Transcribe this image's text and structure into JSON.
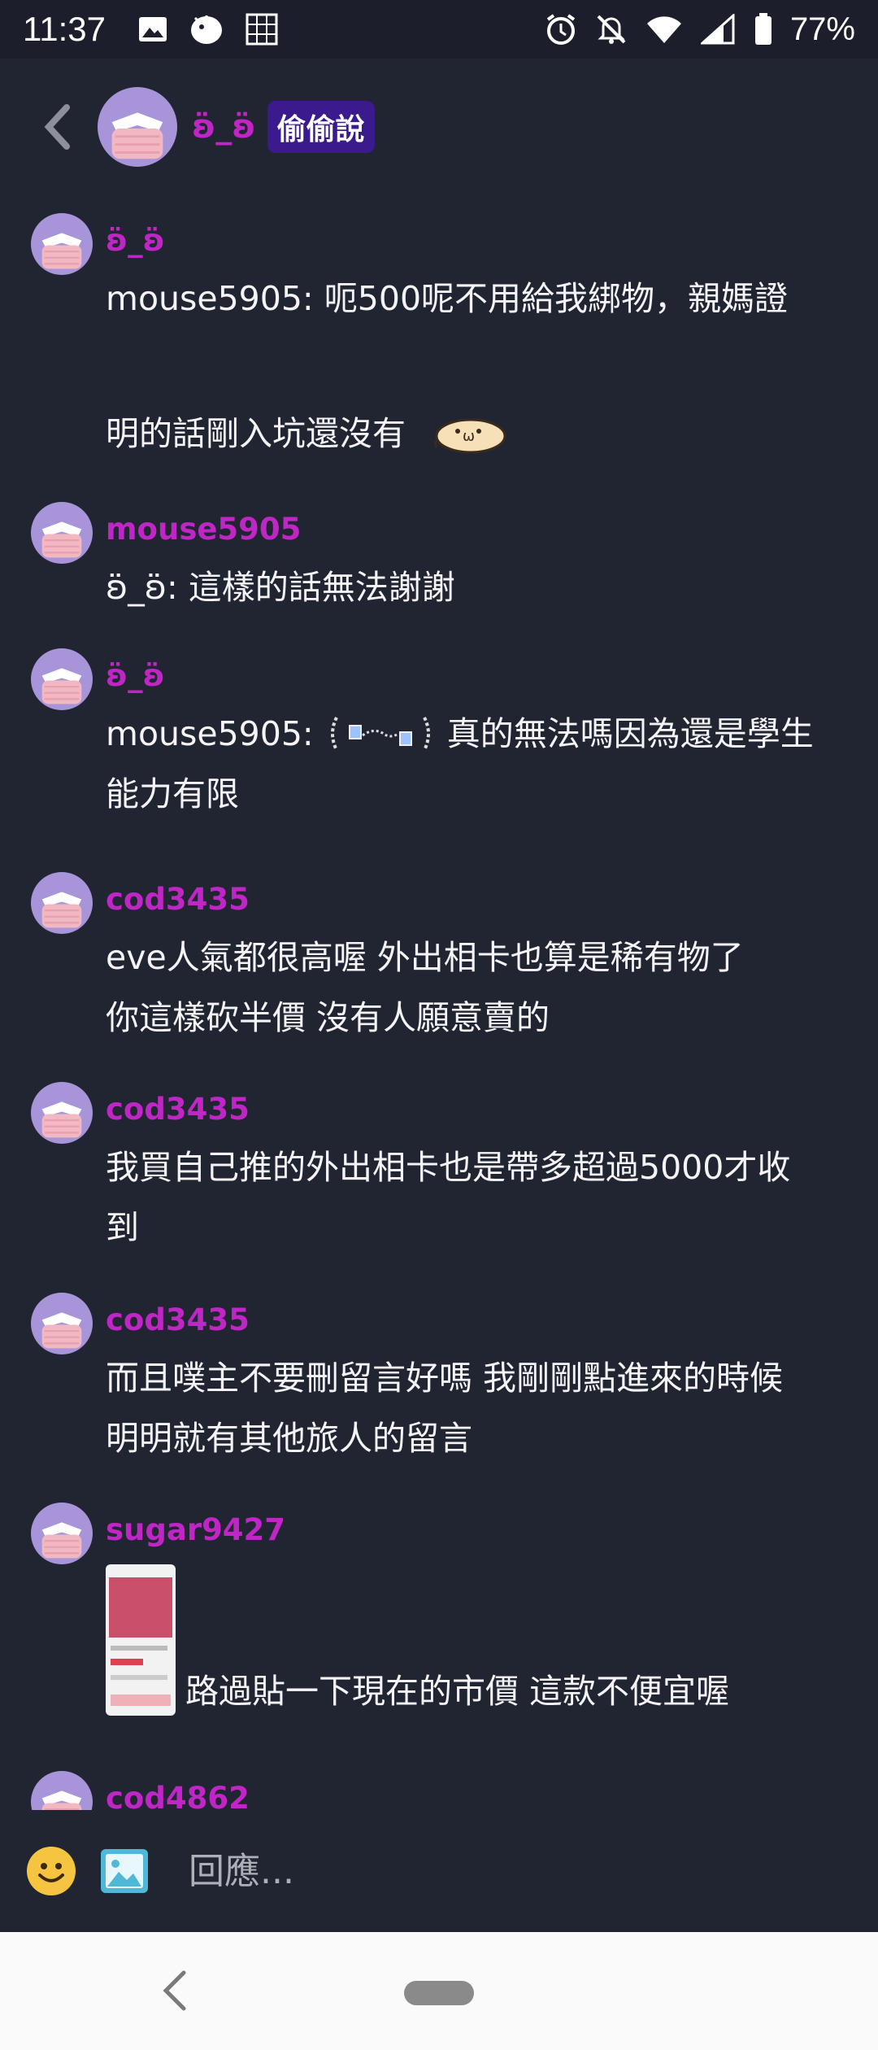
{
  "status_bar": {
    "time": "11:37",
    "battery": "77%",
    "icons": [
      "image-icon",
      "app-icon",
      "grid-icon",
      "alarm-icon",
      "mute-icon",
      "wifi-icon",
      "signal-icon",
      "battery-icon"
    ]
  },
  "header": {
    "title": "ʚ̈_ʚ̈",
    "badge": "偷偷說"
  },
  "messages": [
    {
      "author": "ʚ̈_ʚ̈",
      "line1": "mouse5905: 呃500呢不用給我綁物，親媽證",
      "line2": "明的話剛入坑還沒有"
    },
    {
      "author": "mouse5905",
      "text": "ʚ̈_ʚ̈: 這樣的話無法謝謝"
    },
    {
      "author": "ʚ̈_ʚ̈",
      "prefix": "mouse5905:",
      "text": "真的無法嗎因為還是學生",
      "line2": "能力有限"
    },
    {
      "author": "cod3435",
      "line1": "eve人氣都很高喔 外出相卡也算是稀有物了",
      "line2": "你這樣砍半價 沒有人願意賣的"
    },
    {
      "author": "cod3435",
      "line1": "我買自己推的外出相卡也是帶多超過5000才收",
      "line2": "到"
    },
    {
      "author": "cod3435",
      "line1": "而且噗主不要刪留言好嗎 我剛剛點進來的時候",
      "line2": "明明就有其他旅人的留言"
    },
    {
      "author": "sugar9427",
      "text": "路過貼一下現在的市價 這款不便宜喔"
    },
    {
      "author": "cod4862"
    }
  ],
  "composer": {
    "placeholder": "回應..."
  },
  "colors": {
    "background": "#212532",
    "author": "#c026c6",
    "badge_bg": "#3a1a8c",
    "avatar_bg": "#a894d8",
    "mask": "#f2b8c2"
  }
}
